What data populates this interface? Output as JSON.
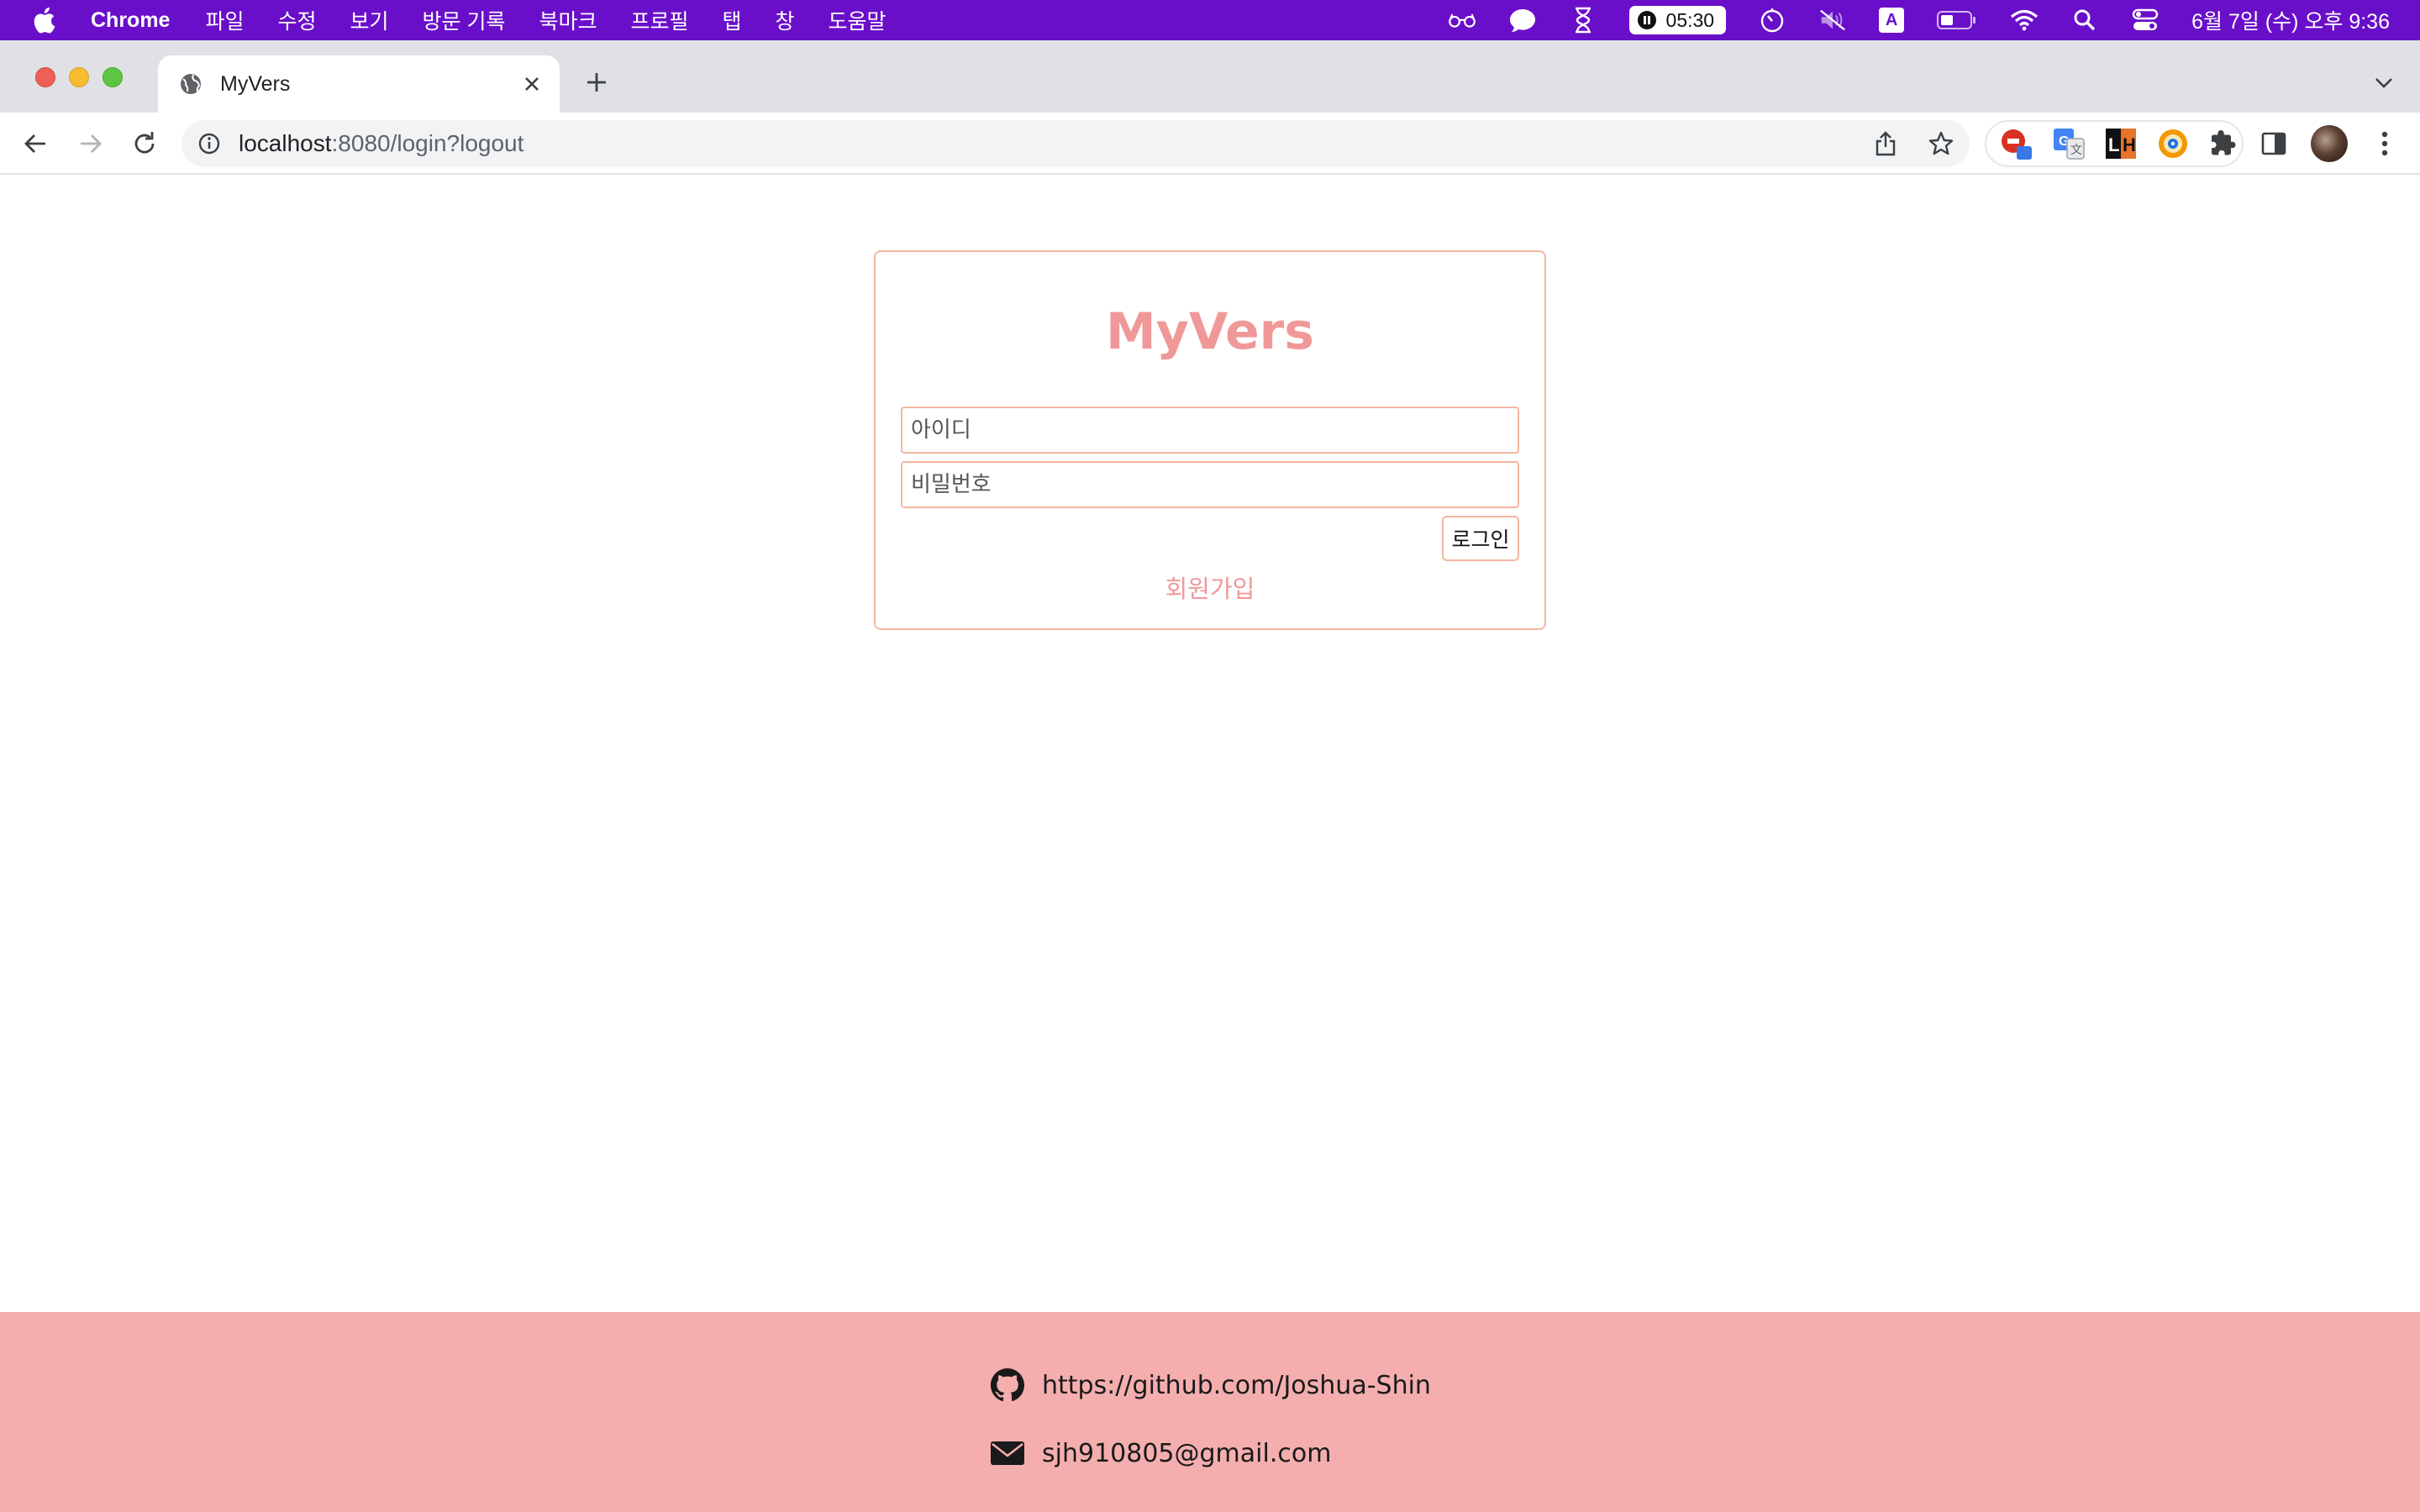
{
  "menubar": {
    "app_name": "Chrome",
    "items": [
      "파일",
      "수정",
      "보기",
      "방문 기록",
      "북마크",
      "프로필",
      "탭",
      "창",
      "도움말"
    ],
    "timer": "05:30",
    "input_indicator": "A",
    "datetime": "6월 7일 (수) 오후 9:36"
  },
  "browser": {
    "tab_title": "MyVers",
    "url_host": "localhost",
    "url_rest": ":8080/login?logout"
  },
  "login": {
    "brand": "MyVers",
    "id_placeholder": "아이디",
    "password_placeholder": "비밀번호",
    "login_label": "로그인",
    "signup_label": "회원가입"
  },
  "footer": {
    "github": "https://github.com/Joshua-Shin",
    "email": "sjh910805@gmail.com"
  },
  "colors": {
    "menubar_bg": "#6a0fc9",
    "brand_pink": "#f09898",
    "border_peach": "#f4b6a0",
    "footer_bg": "#f4aeae"
  }
}
